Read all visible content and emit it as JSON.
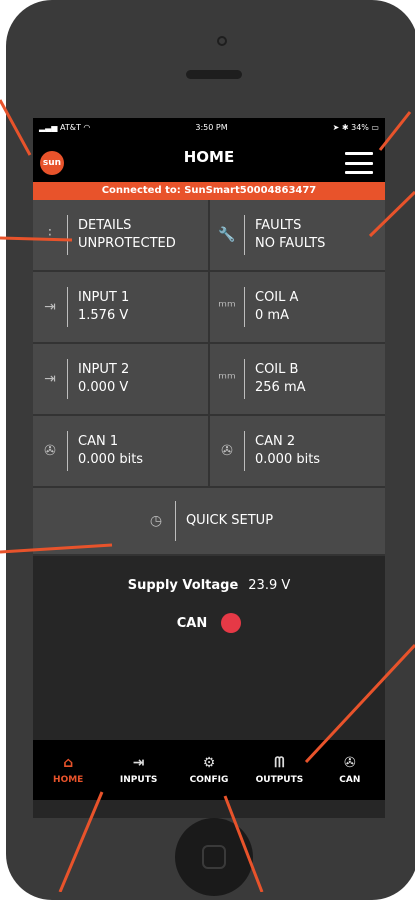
{
  "status_bar": {
    "carrier": "AT&T",
    "time": "3:50 PM",
    "battery": "34%"
  },
  "header": {
    "logo_text": "sun",
    "title": "HOME"
  },
  "connection_banner": "Connected to: SunSmart50004863477",
  "tiles": [
    {
      "label": "DETAILS",
      "value": "UNPROTECTED",
      "icon": "more-vertical-icon"
    },
    {
      "label": "FAULTS",
      "value": "NO FAULTS",
      "icon": "wrench-icon"
    },
    {
      "label": "INPUT 1",
      "value": "1.576 V",
      "icon": "input-icon"
    },
    {
      "label": "COIL A",
      "value": "0 mA",
      "icon": "coil-icon"
    },
    {
      "label": "INPUT 2",
      "value": "0.000 V",
      "icon": "input-icon"
    },
    {
      "label": "COIL B",
      "value": "256 mA",
      "icon": "coil-icon"
    },
    {
      "label": "CAN 1",
      "value": "0.000 bits",
      "icon": "can-icon"
    },
    {
      "label": "CAN 2",
      "value": "0.000 bits",
      "icon": "can-icon"
    }
  ],
  "quick_setup": {
    "label": "QUICK SETUP",
    "icon": "timer-icon"
  },
  "supply": {
    "label": "Supply Voltage",
    "value": "23.9 V"
  },
  "can_status": {
    "label": "CAN",
    "color": "#e63946"
  },
  "nav": [
    {
      "label": "HOME",
      "icon": "home-icon",
      "active": true
    },
    {
      "label": "INPUTS",
      "icon": "input-icon",
      "active": false
    },
    {
      "label": "CONFIG",
      "icon": "gear-icon",
      "active": false
    },
    {
      "label": "OUTPUTS",
      "icon": "outputs-icon",
      "active": false
    },
    {
      "label": "CAN",
      "icon": "can-icon",
      "active": false
    }
  ],
  "colors": {
    "accent": "#e8532b",
    "panel": "#494949",
    "background": "#262626"
  }
}
